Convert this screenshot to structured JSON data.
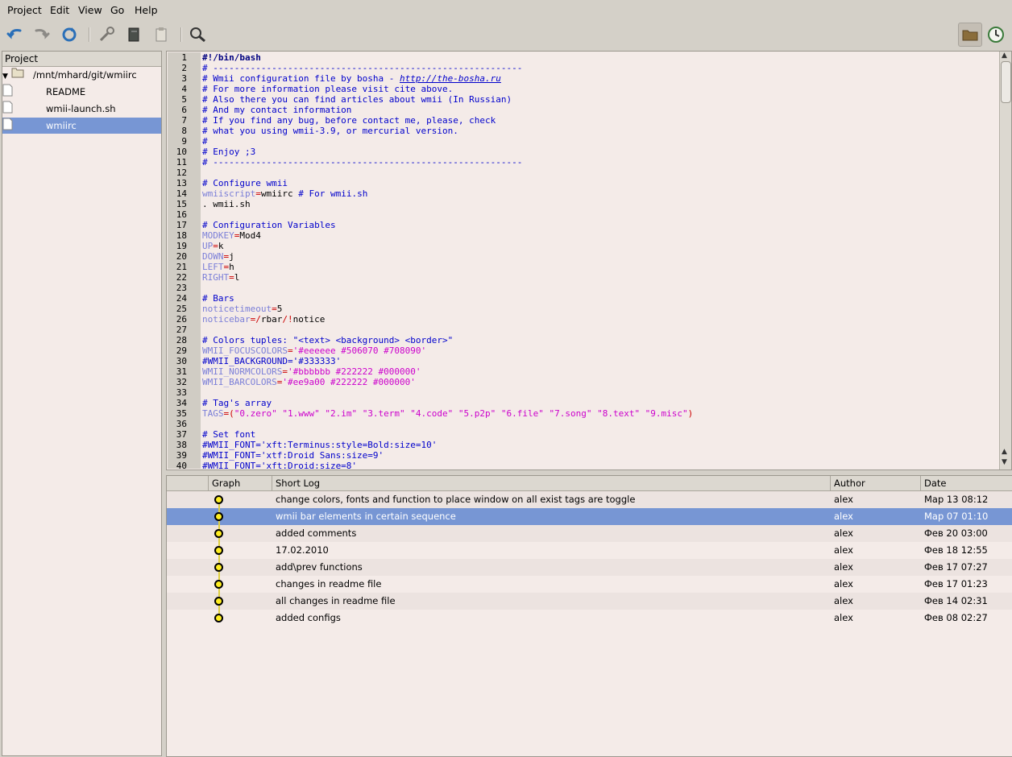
{
  "menu": [
    "Project",
    "Edit",
    "View",
    "Go",
    "Help"
  ],
  "toolbar": {
    "buttons": [
      "undo-icon",
      "redo-icon",
      "refresh-icon",
      "tools-icon",
      "book-icon",
      "clipboard-icon",
      "find-icon"
    ],
    "right_buttons": [
      "folder-icon",
      "history-icon"
    ]
  },
  "project": {
    "header": "Project",
    "root": "/mnt/mhard/git/wmiirc",
    "files": [
      "README",
      "wmii-launch.sh",
      "wmiirc"
    ],
    "selected": "wmiirc"
  },
  "editor": {
    "lines": [
      {
        "n": "1",
        "t": "shebang",
        "s": "#!/bin/bash"
      },
      {
        "n": "2",
        "t": "comment",
        "s": "# ----------------------------------------------------------"
      },
      {
        "n": "3",
        "t": "comment",
        "s": "# Wmii configuration file by bosha - ",
        "link": "http://the-bosha.ru"
      },
      {
        "n": "4",
        "t": "comment",
        "s": "# For more information please visit cite above."
      },
      {
        "n": "5",
        "t": "comment",
        "s": "# Also there you can find articles about wmii (In Russian)"
      },
      {
        "n": "6",
        "t": "comment",
        "s": "# And my contact information"
      },
      {
        "n": "7",
        "t": "comment",
        "s": "# If you find any bug, before contact me, please, check"
      },
      {
        "n": "8",
        "t": "comment",
        "s": "# what you using wmii-3.9, or mercurial version."
      },
      {
        "n": "9",
        "t": "comment",
        "s": "#"
      },
      {
        "n": "10",
        "t": "comment",
        "s": "# Enjoy ;3"
      },
      {
        "n": "11",
        "t": "comment",
        "s": "# ----------------------------------------------------------"
      },
      {
        "n": "12",
        "t": "plain",
        "s": ""
      },
      {
        "n": "13",
        "t": "comment",
        "s": "# Configure wmii"
      },
      {
        "n": "14",
        "t": "mixed",
        "parts": [
          [
            "var",
            "wmiiscript"
          ],
          [
            "op",
            "="
          ],
          [
            "plain",
            "wmiirc "
          ],
          [
            "comment",
            "# For wmii.sh"
          ]
        ]
      },
      {
        "n": "15",
        "t": "plain",
        "s": ". wmii.sh"
      },
      {
        "n": "16",
        "t": "plain",
        "s": ""
      },
      {
        "n": "17",
        "t": "comment",
        "s": "# Configuration Variables"
      },
      {
        "n": "18",
        "t": "mixed",
        "parts": [
          [
            "var",
            "MODKEY"
          ],
          [
            "op",
            "="
          ],
          [
            "plain",
            "Mod4"
          ]
        ]
      },
      {
        "n": "19",
        "t": "mixed",
        "parts": [
          [
            "var",
            "UP"
          ],
          [
            "op",
            "="
          ],
          [
            "plain",
            "k"
          ]
        ]
      },
      {
        "n": "20",
        "t": "mixed",
        "parts": [
          [
            "var",
            "DOWN"
          ],
          [
            "op",
            "="
          ],
          [
            "plain",
            "j"
          ]
        ]
      },
      {
        "n": "21",
        "t": "mixed",
        "parts": [
          [
            "var",
            "LEFT"
          ],
          [
            "op",
            "="
          ],
          [
            "plain",
            "h"
          ]
        ]
      },
      {
        "n": "22",
        "t": "mixed",
        "parts": [
          [
            "var",
            "RIGHT"
          ],
          [
            "op",
            "="
          ],
          [
            "plain",
            "l"
          ]
        ]
      },
      {
        "n": "23",
        "t": "plain",
        "s": ""
      },
      {
        "n": "24",
        "t": "comment",
        "s": "# Bars"
      },
      {
        "n": "25",
        "t": "mixed",
        "parts": [
          [
            "var",
            "noticetimeout"
          ],
          [
            "op",
            "="
          ],
          [
            "plain",
            "5"
          ]
        ]
      },
      {
        "n": "26",
        "t": "mixed",
        "parts": [
          [
            "var",
            "noticebar"
          ],
          [
            "op",
            "=/"
          ],
          [
            "plain",
            "rbar"
          ],
          [
            "op",
            "/!"
          ],
          [
            "plain",
            "notice"
          ]
        ]
      },
      {
        "n": "27",
        "t": "plain",
        "s": ""
      },
      {
        "n": "28",
        "t": "comment",
        "s": "# Colors tuples: \"<text> <background> <border>\""
      },
      {
        "n": "29",
        "t": "mixed",
        "parts": [
          [
            "var",
            "WMII_FOCUSCOLORS"
          ],
          [
            "op",
            "="
          ],
          [
            "str",
            "'#eeeeee #506070 #708090'"
          ]
        ]
      },
      {
        "n": "30",
        "t": "comment",
        "s": "#WMII_BACKGROUND='#333333'"
      },
      {
        "n": "31",
        "t": "mixed",
        "parts": [
          [
            "var",
            "WMII_NORMCOLORS"
          ],
          [
            "op",
            "="
          ],
          [
            "str",
            "'#bbbbbb #222222 #000000'"
          ]
        ]
      },
      {
        "n": "32",
        "t": "mixed",
        "parts": [
          [
            "var",
            "WMII_BARCOLORS"
          ],
          [
            "op",
            "="
          ],
          [
            "str",
            "'#ee9a00 #222222 #000000'"
          ]
        ]
      },
      {
        "n": "33",
        "t": "plain",
        "s": ""
      },
      {
        "n": "34",
        "t": "comment",
        "s": "# Tag's array"
      },
      {
        "n": "35",
        "t": "mixed",
        "parts": [
          [
            "var",
            "TAGS"
          ],
          [
            "op",
            "=("
          ],
          [
            "str",
            "\"0.zero\" \"1.www\" \"2.im\" \"3.term\" \"4.code\" \"5.p2p\" \"6.file\" \"7.song\" \"8.text\" \"9.misc\""
          ],
          [
            "op",
            ")"
          ]
        ]
      },
      {
        "n": "36",
        "t": "plain",
        "s": ""
      },
      {
        "n": "37",
        "t": "comment",
        "s": "# Set font"
      },
      {
        "n": "38",
        "t": "comment",
        "s": "#WMII_FONT='xft:Terminus:style=Bold:size=10'"
      },
      {
        "n": "39",
        "t": "comment",
        "s": "#WMII_FONT='xtf:Droid Sans:size=9'"
      },
      {
        "n": "40",
        "t": "comment",
        "s": "#WMII_FONT='xft:Droid:size=8'"
      }
    ]
  },
  "log": {
    "columns": [
      "Graph",
      "Short Log",
      "Author",
      "Date"
    ],
    "rows": [
      {
        "msg": "change colors, fonts and function to place window on all exist tags are toggle",
        "author": "alex",
        "date": "Мар 13 08:12"
      },
      {
        "msg": "wmii bar elements in certain sequence",
        "author": "alex",
        "date": "Мар 07 01:10"
      },
      {
        "msg": "added comments",
        "author": "alex",
        "date": "Фев 20 03:00"
      },
      {
        "msg": "17.02.2010",
        "author": "alex",
        "date": "Фев 18 12:55"
      },
      {
        "msg": "add\\prev functions",
        "author": "alex",
        "date": "Фев 17 07:27"
      },
      {
        "msg": "changes in readme file",
        "author": "alex",
        "date": "Фев 17 01:23"
      },
      {
        "msg": "all changes in readme file",
        "author": "alex",
        "date": "Фев 14 02:31"
      },
      {
        "msg": "added configs",
        "author": "alex",
        "date": "Фев 08 02:27"
      }
    ],
    "selected_index": 1
  }
}
